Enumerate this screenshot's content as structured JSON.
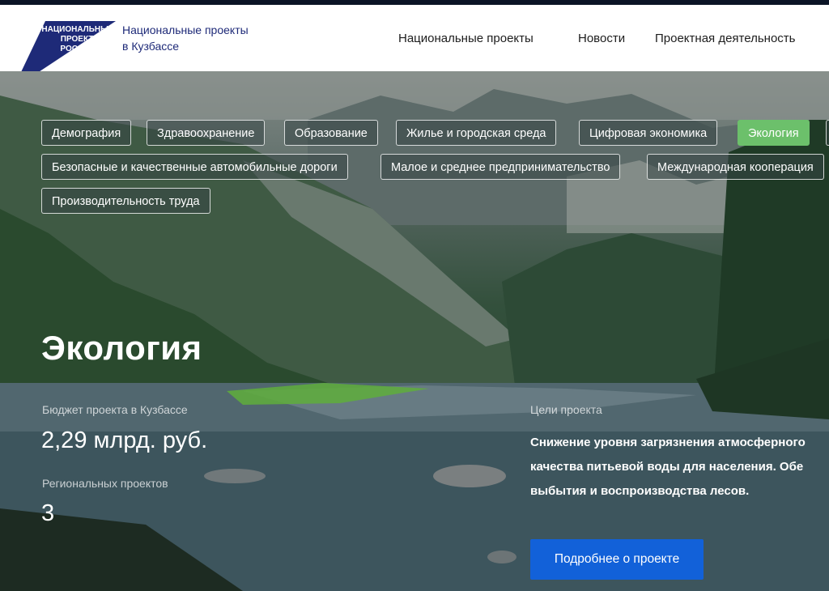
{
  "header": {
    "logo_lines": [
      "НАЦИОНАЛЬНЫЕ",
      "ПРОЕКТЫ",
      "РОССИИ"
    ],
    "site_title_line1": "Национальные проекты",
    "site_title_line2": "в Кузбассе",
    "brand_color": "#1e2a78",
    "nav": [
      {
        "label": "Национальные проекты"
      },
      {
        "label": "Новости"
      },
      {
        "label": "Проектная деятельность"
      }
    ]
  },
  "tags": [
    {
      "label": "Демография",
      "active": false
    },
    {
      "label": "Здравоохранение",
      "active": false
    },
    {
      "label": "Образование",
      "active": false
    },
    {
      "label": "Жилье и городская среда",
      "active": false
    },
    {
      "label": "Цифровая экономика",
      "active": false
    },
    {
      "label": "Экология",
      "active": true
    },
    {
      "label": "Безопасные и качественные автомобильные дороги",
      "active": false
    },
    {
      "label": "Малое и среднее предпринимательство",
      "active": false
    },
    {
      "label": "Международная кооперация",
      "active": false
    },
    {
      "label": "Производительность труда",
      "active": false
    }
  ],
  "project": {
    "title": "Экология",
    "budget_label": "Бюджет проекта в Кузбассе",
    "budget_value": "2,29 млрд. руб.",
    "regional_label": "Региональных проектов",
    "regional_value": "3",
    "goals_label": "Цели проекта",
    "goals_lines": [
      "Снижение уровня загрязнения атмосферного",
      "качества питьевой воды для населения. Обе",
      "выбытия и воспроизводства лесов."
    ],
    "button_label": "Подробнее о проекте"
  },
  "colors": {
    "active_tag": "#6cc06b",
    "button": "#1261d9"
  }
}
